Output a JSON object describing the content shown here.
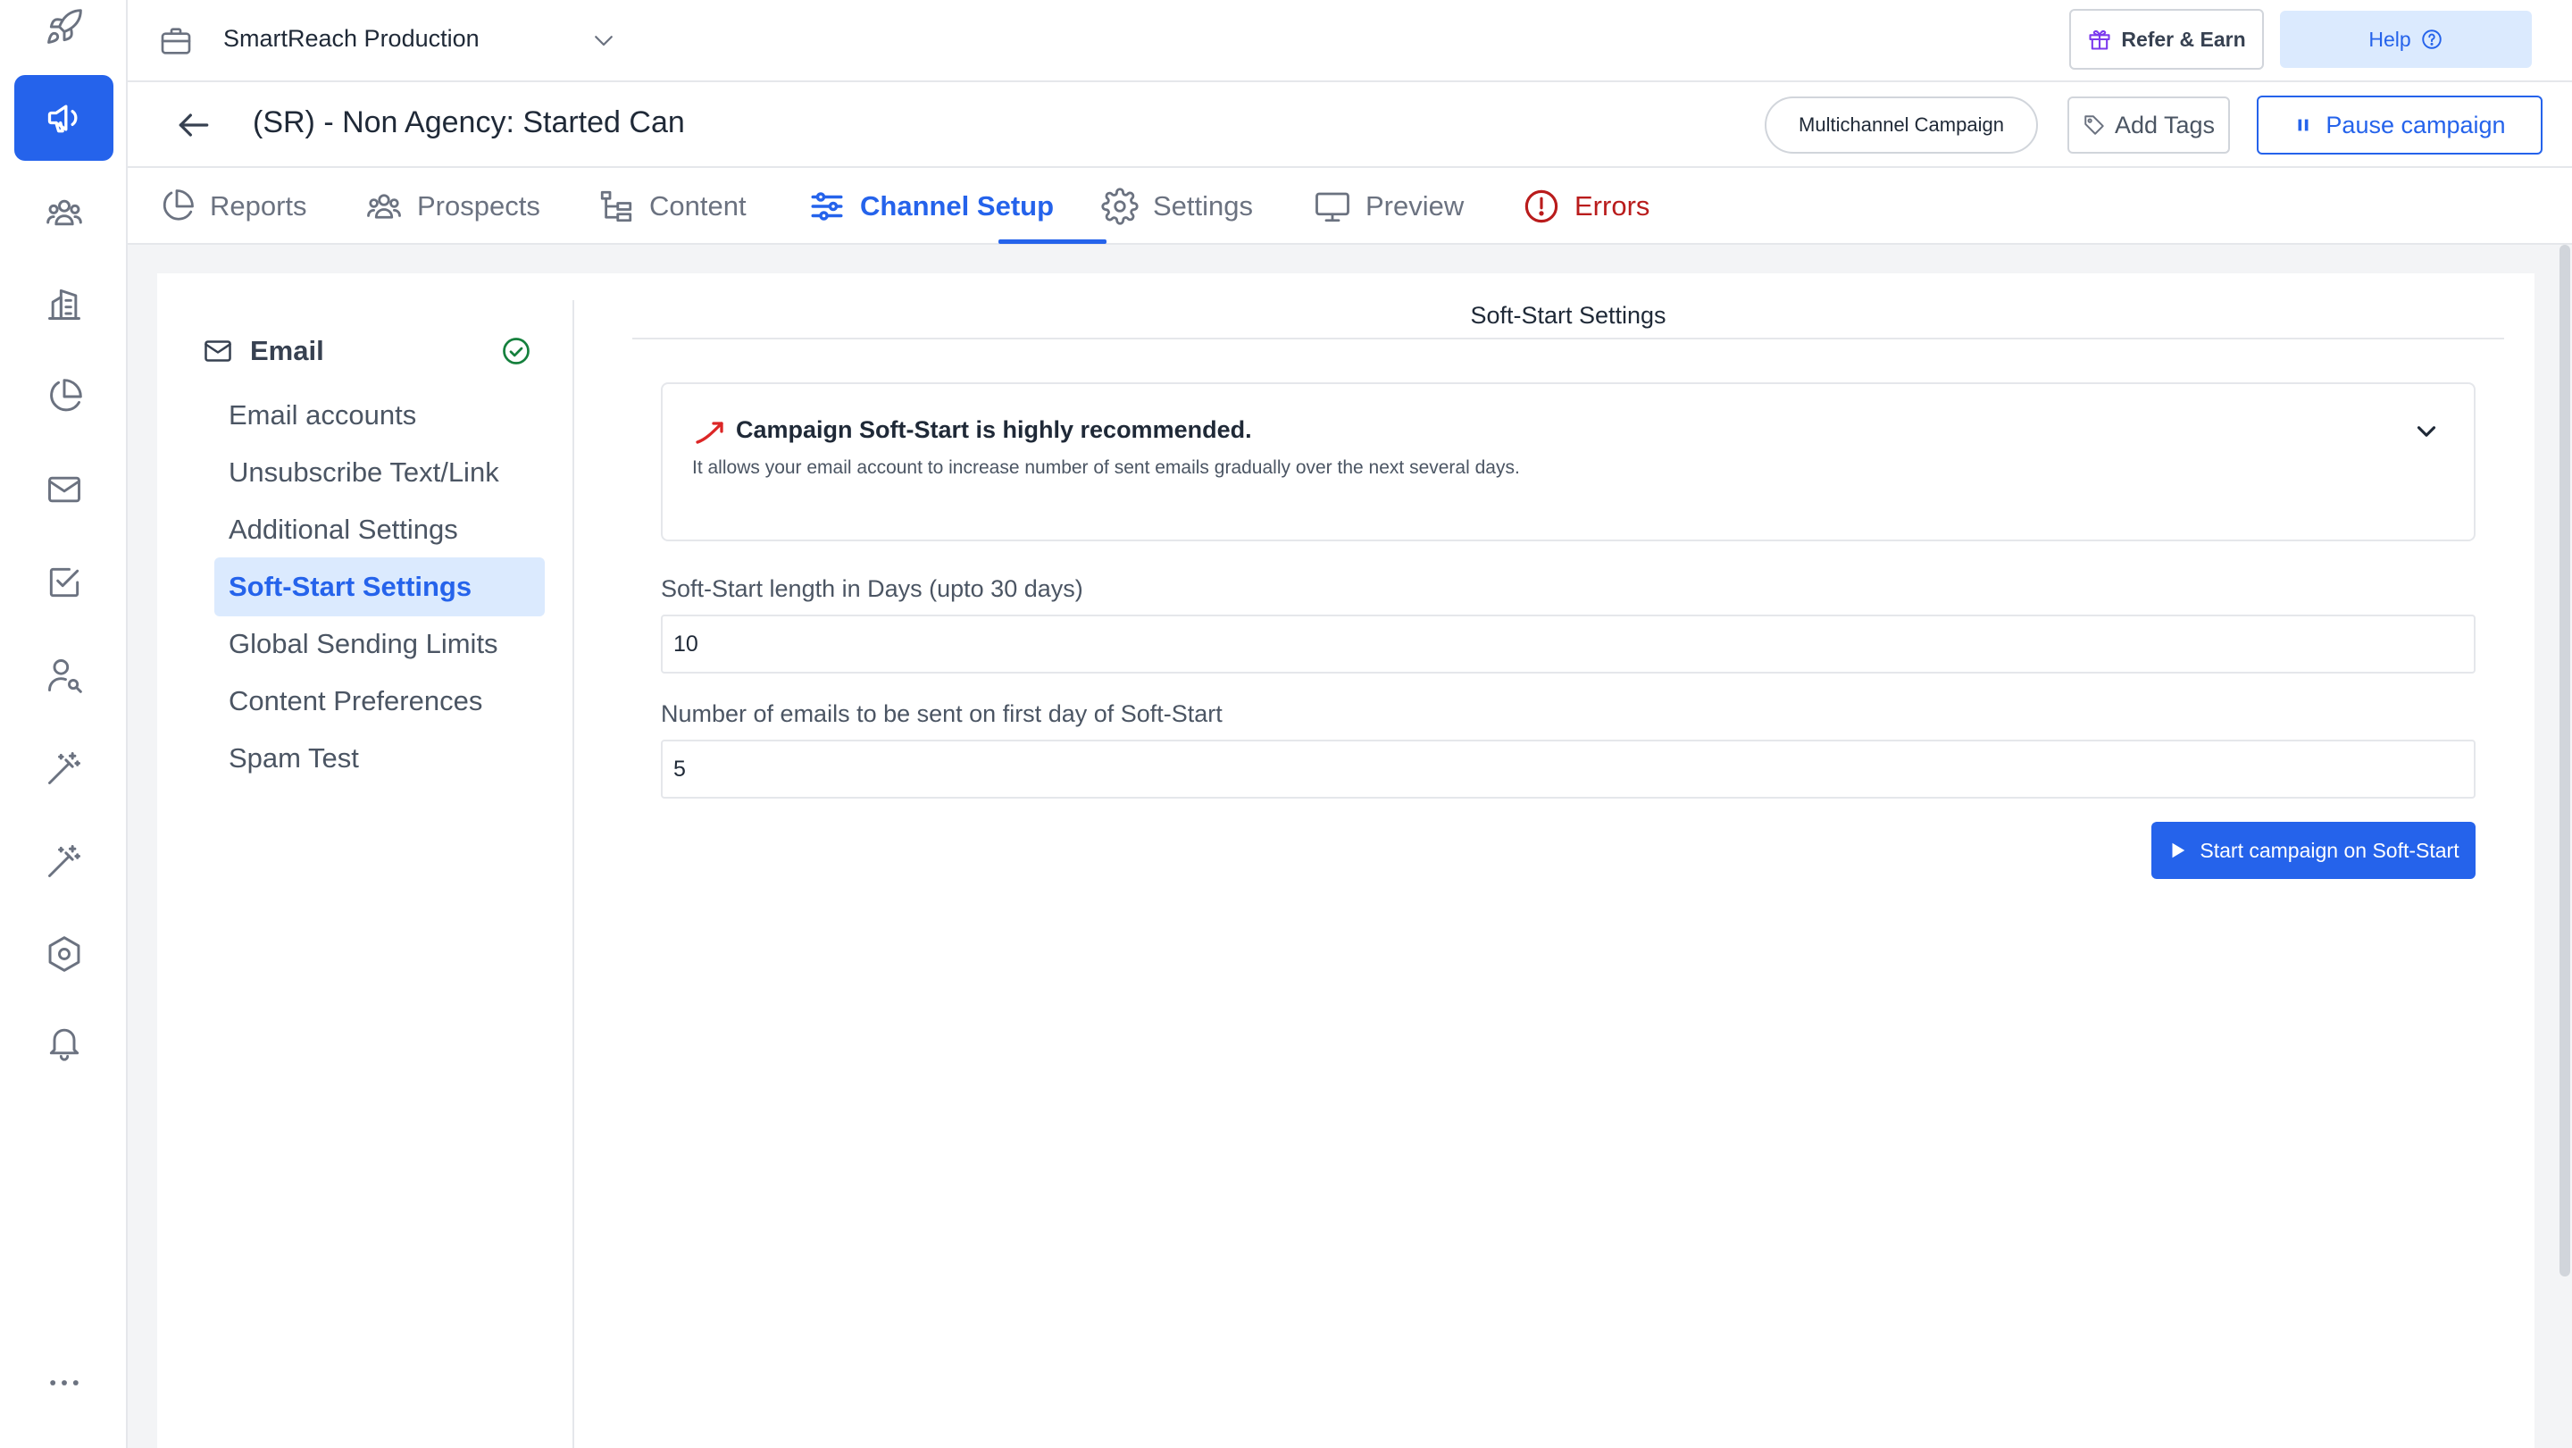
{
  "workspace": {
    "name": "SmartReach Production"
  },
  "top_actions": {
    "refer_label": "Refer & Earn",
    "help_label": "Help"
  },
  "campaign": {
    "title": "(SR) - Non Agency: Started Can",
    "type_label": "Multichannel Campaign",
    "add_tags_label": "Add Tags",
    "pause_label": "Pause campaign"
  },
  "tabs": [
    {
      "label": "Reports",
      "icon": "pie-chart-icon"
    },
    {
      "label": "Prospects",
      "icon": "people-icon"
    },
    {
      "label": "Content",
      "icon": "tree-icon"
    },
    {
      "label": "Channel Setup",
      "icon": "sliders-icon",
      "active": true
    },
    {
      "label": "Settings",
      "icon": "gear-icon"
    },
    {
      "label": "Preview",
      "icon": "monitor-icon"
    },
    {
      "label": "Errors",
      "icon": "alert-circle-icon"
    }
  ],
  "subnav": {
    "heading": "Email",
    "items": [
      {
        "label": "Email accounts"
      },
      {
        "label": "Unsubscribe Text/Link"
      },
      {
        "label": "Additional Settings"
      },
      {
        "label": "Soft-Start Settings",
        "active": true
      },
      {
        "label": "Global Sending Limits"
      },
      {
        "label": "Content Preferences"
      },
      {
        "label": "Spam Test"
      }
    ]
  },
  "soft_start": {
    "section_title": "Soft-Start Settings",
    "info_title": "Campaign Soft-Start is highly recommended.",
    "info_desc": "It allows your email account to increase number of sent emails gradually over the next several days.",
    "length_label": "Soft-Start length in Days (upto 30 days)",
    "length_value": "10",
    "first_day_label": "Number of emails to be sent on first day of Soft-Start",
    "first_day_value": "5",
    "start_button_label": "Start campaign on Soft-Start"
  },
  "colors": {
    "primary": "#2563eb",
    "error": "#b91c1c",
    "success": "#15803d",
    "trend": "#dc2626"
  },
  "rail_icons": [
    "rocket-icon",
    "megaphone-icon",
    "users-icon",
    "building-icon",
    "pie-chart-icon",
    "mail-icon",
    "checkbox-icon",
    "user-search-icon",
    "magic-wand-icon",
    "magic-wand-icon",
    "hexagon-settings-icon",
    "bell-icon",
    "more-icon"
  ]
}
